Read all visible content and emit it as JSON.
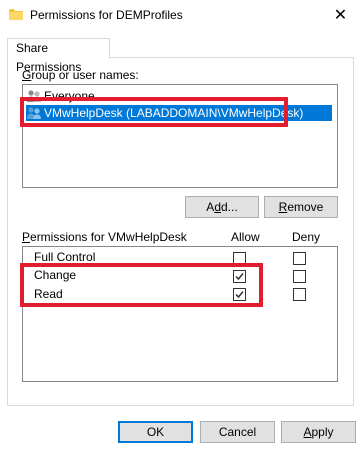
{
  "window": {
    "title": "Permissions for DEMProfiles",
    "close_glyph": "✕",
    "icon": "folder-icon"
  },
  "tabs": [
    {
      "label": "Share Permissions"
    }
  ],
  "group_section": {
    "label_accel": "G",
    "label_rest": "roup or user names:",
    "items": [
      {
        "label": "Everyone",
        "selected": false,
        "icon": "group-icon"
      },
      {
        "label": "VMwHelpDesk (LABADDOMAIN\\VMwHelpDesk)",
        "selected": true,
        "icon": "group-icon"
      }
    ]
  },
  "buttons": {
    "add_accel": "d",
    "add_pre": "A",
    "add_post": "d...",
    "remove_accel": "R",
    "remove_rest": "emove",
    "ok": "OK",
    "cancel": "Cancel",
    "apply_accel": "A",
    "apply_rest": "pply"
  },
  "permissions": {
    "label_accel": "P",
    "label_rest": "ermissions for VMwHelpDesk",
    "allow_header": "Allow",
    "deny_header": "Deny",
    "rows": [
      {
        "name": "Full Control",
        "allow": false,
        "deny": false
      },
      {
        "name": "Change",
        "allow": true,
        "deny": false
      },
      {
        "name": "Read",
        "allow": true,
        "deny": false
      }
    ]
  },
  "colors": {
    "highlight": "#e31d30",
    "selection": "#0078d7"
  }
}
